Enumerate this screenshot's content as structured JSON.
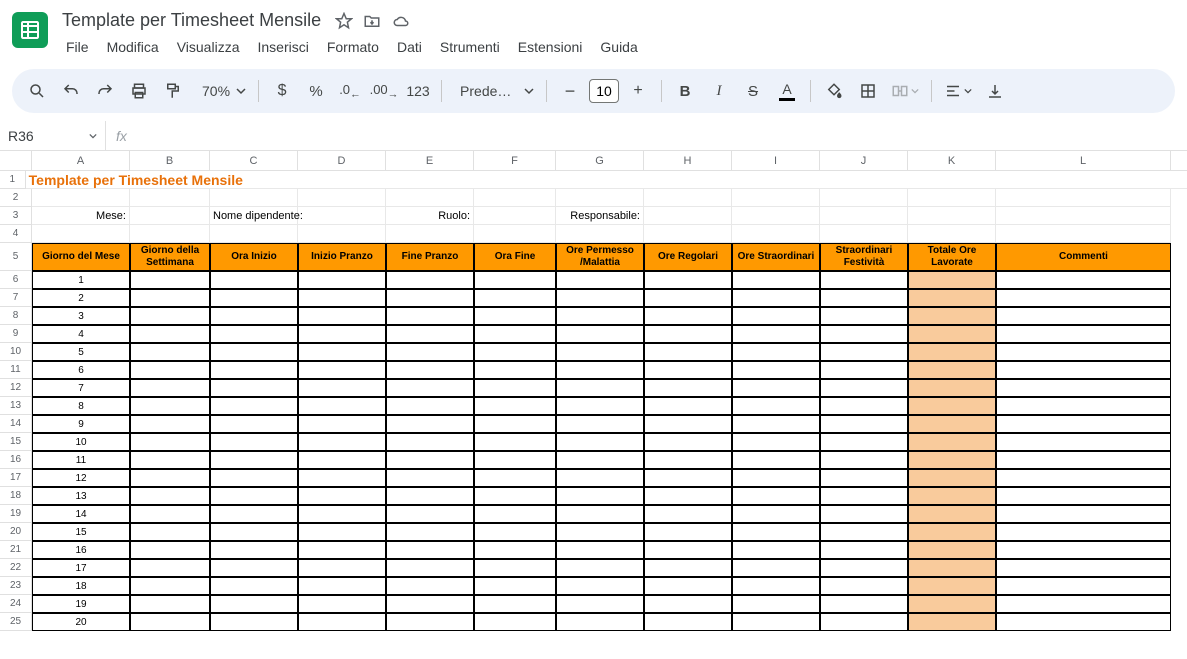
{
  "doc": {
    "title": "Template per Timesheet Mensile"
  },
  "menu": {
    "file": "File",
    "edit": "Modifica",
    "view": "Visualizza",
    "insert": "Inserisci",
    "format": "Formato",
    "data": "Dati",
    "tools": "Strumenti",
    "extensions": "Estensioni",
    "help": "Guida"
  },
  "toolbar": {
    "zoom": "70%",
    "font": "Prede…",
    "fontSize": "10",
    "numfmt": "123"
  },
  "nameBox": "R36",
  "columns": [
    "A",
    "B",
    "C",
    "D",
    "E",
    "F",
    "G",
    "H",
    "I",
    "J",
    "K",
    "L"
  ],
  "rowNumbers": [
    1,
    2,
    3,
    4,
    5,
    6,
    7,
    8,
    9,
    10,
    11,
    12,
    13,
    14,
    15,
    16,
    17,
    18,
    19,
    20,
    21,
    22,
    23,
    24,
    25
  ],
  "sheet": {
    "title": "Template per Timesheet Mensile",
    "labels": {
      "mese": "Mese:",
      "nome": "Nome dipendente:",
      "ruolo": "Ruolo:",
      "responsabile": "Responsabile:"
    },
    "headers": [
      "Giorno del Mese",
      "Giorno della Settimana",
      "Ora Inizio",
      "Inizio Pranzo",
      "Fine Pranzo",
      "Ora Fine",
      "Ore Permesso /Malattia",
      "Ore Regolari",
      "Ore Straordinari",
      "Straordinari Festività",
      "Totale Ore Lavorate",
      "Commenti"
    ],
    "days": [
      1,
      2,
      3,
      4,
      5,
      6,
      7,
      8,
      9,
      10,
      11,
      12,
      13,
      14,
      15,
      16,
      17,
      18,
      19,
      20
    ]
  }
}
